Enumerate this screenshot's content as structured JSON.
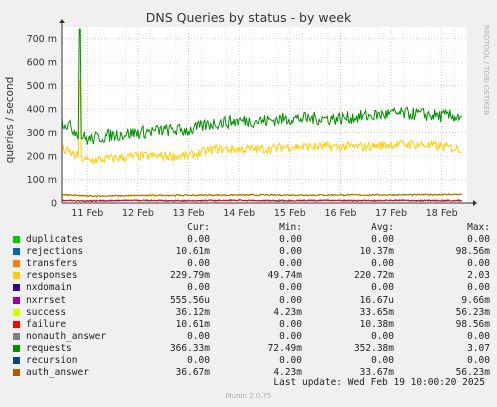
{
  "watermark": "RRDTOOL / TOBI OETIKER",
  "legend_headers": {
    "cur": "Cur:",
    "min": "Min:",
    "avg": "Avg:",
    "max": "Max:"
  },
  "legend": [
    {
      "name": "duplicates",
      "color": "#00cc00",
      "cur": "0.00",
      "min": "0.00",
      "avg": "0.00",
      "max": "0.00"
    },
    {
      "name": "rejections",
      "color": "#0066b3",
      "cur": "10.61m",
      "min": "0.00",
      "avg": "10.37m",
      "max": "98.56m"
    },
    {
      "name": "transfers",
      "color": "#ff8000",
      "cur": "0.00",
      "min": "0.00",
      "avg": "0.00",
      "max": "0.00"
    },
    {
      "name": "responses",
      "color": "#ffcc00",
      "cur": "229.79m",
      "min": "49.74m",
      "avg": "220.72m",
      "max": "2.03"
    },
    {
      "name": "nxdomain",
      "color": "#330099",
      "cur": "0.00",
      "min": "0.00",
      "avg": "0.00",
      "max": "0.00"
    },
    {
      "name": "nxrrset",
      "color": "#990099",
      "cur": "555.56u",
      "min": "0.00",
      "avg": "16.67u",
      "max": "9.66m"
    },
    {
      "name": "success",
      "color": "#ccff00",
      "cur": "36.12m",
      "min": "4.23m",
      "avg": "33.65m",
      "max": "56.23m"
    },
    {
      "name": "failure",
      "color": "#ff0000",
      "cur": "10.61m",
      "min": "0.00",
      "avg": "10.38m",
      "max": "98.56m"
    },
    {
      "name": "nonauth_answer",
      "color": "#808080",
      "cur": "0.00",
      "min": "0.00",
      "avg": "0.00",
      "max": "0.00"
    },
    {
      "name": "requests",
      "color": "#008f00",
      "cur": "366.33m",
      "min": "72.49m",
      "avg": "352.38m",
      "max": "3.07"
    },
    {
      "name": "recursion",
      "color": "#00487d",
      "cur": "0.00",
      "min": "0.00",
      "avg": "0.00",
      "max": "0.00"
    },
    {
      "name": "auth_answer",
      "color": "#b35a00",
      "cur": "36.67m",
      "min": "4.23m",
      "avg": "33.67m",
      "max": "56.23m"
    }
  ],
  "last_update": "Last update: Wed Feb 19 10:00:20 2025",
  "footer": "Munin 2.0.75",
  "chart_data": {
    "type": "line",
    "title": "DNS Queries by status - by week",
    "ylabel": "queries / second",
    "xlabel": "",
    "ylim": [
      0,
      0.75
    ],
    "yticks": [
      0,
      0.1,
      0.2,
      0.3,
      0.4,
      0.5,
      0.6,
      0.7
    ],
    "ytick_labels": [
      "0",
      "100 m",
      "200 m",
      "300 m",
      "400 m",
      "500 m",
      "600 m",
      "700 m"
    ],
    "categories": [
      "11 Feb",
      "12 Feb",
      "13 Feb",
      "14 Feb",
      "15 Feb",
      "16 Feb",
      "17 Feb",
      "18 Feb"
    ],
    "x": [
      0,
      0.5,
      1,
      1.5,
      2,
      2.5,
      3,
      3.5,
      4,
      4.5,
      5,
      5.5,
      6,
      6.5,
      7,
      7.5,
      7.9
    ],
    "series": [
      {
        "name": "requests",
        "color": "#008f00",
        "values": [
          0.35,
          0.27,
          0.29,
          0.3,
          0.31,
          0.31,
          0.34,
          0.35,
          0.35,
          0.36,
          0.36,
          0.36,
          0.37,
          0.38,
          0.38,
          0.37,
          0.37
        ]
      },
      {
        "name": "responses",
        "color": "#ffcc00",
        "values": [
          0.23,
          0.18,
          0.19,
          0.2,
          0.2,
          0.2,
          0.23,
          0.23,
          0.23,
          0.24,
          0.24,
          0.24,
          0.24,
          0.25,
          0.25,
          0.24,
          0.23
        ]
      },
      {
        "name": "auth_answer",
        "color": "#b35a00",
        "values": [
          0.035,
          0.03,
          0.03,
          0.032,
          0.033,
          0.033,
          0.034,
          0.034,
          0.034,
          0.034,
          0.034,
          0.034,
          0.034,
          0.035,
          0.035,
          0.036,
          0.037
        ]
      },
      {
        "name": "success",
        "color": "#ccff00",
        "values": [
          0.034,
          0.03,
          0.03,
          0.031,
          0.032,
          0.032,
          0.033,
          0.033,
          0.033,
          0.033,
          0.034,
          0.034,
          0.034,
          0.034,
          0.035,
          0.036,
          0.036
        ]
      },
      {
        "name": "failure",
        "color": "#ff0000",
        "values": [
          0.01,
          0.009,
          0.01,
          0.011,
          0.01,
          0.01,
          0.01,
          0.011,
          0.01,
          0.01,
          0.011,
          0.01,
          0.01,
          0.011,
          0.01,
          0.01,
          0.011
        ]
      },
      {
        "name": "rejections",
        "color": "#0066b3",
        "values": [
          0.01,
          0.009,
          0.01,
          0.011,
          0.01,
          0.01,
          0.01,
          0.011,
          0.01,
          0.01,
          0.011,
          0.01,
          0.01,
          0.011,
          0.01,
          0.01,
          0.011
        ]
      }
    ],
    "spike": {
      "x": 0.35,
      "requests": 0.74,
      "responses": 0.52
    },
    "grid": true
  }
}
